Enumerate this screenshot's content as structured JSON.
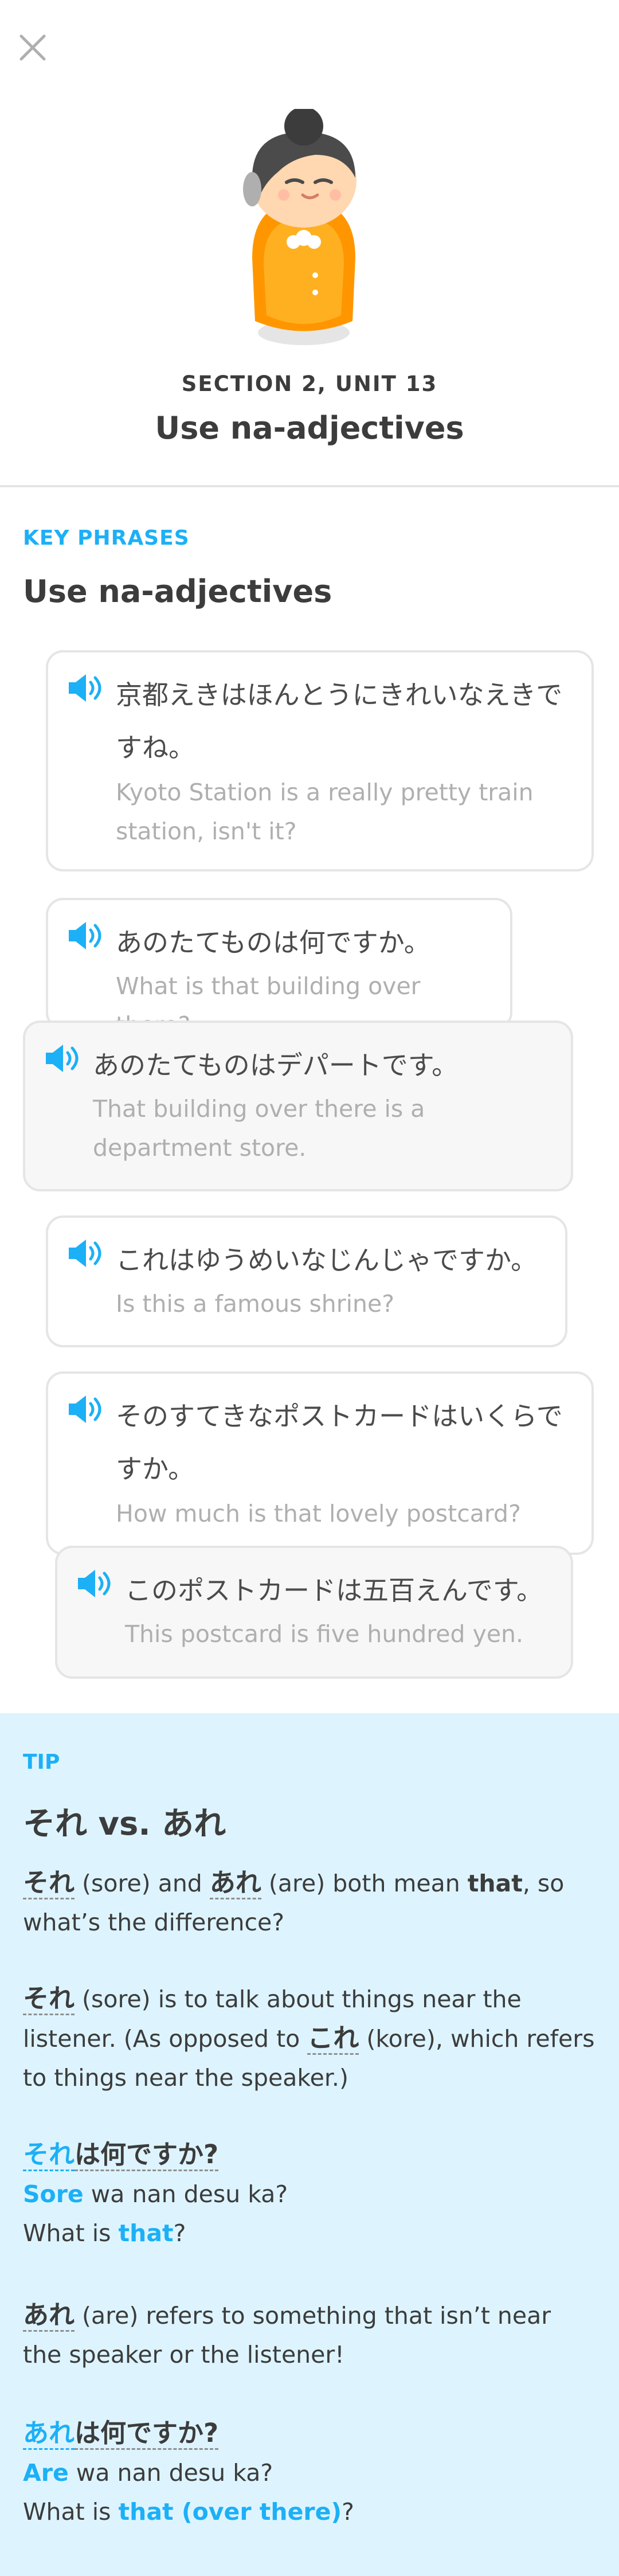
{
  "header": {
    "section_label": "SECTION 2, UNIT 13",
    "unit_title": "Use na-adjectives"
  },
  "key_phrases": {
    "label": "KEY PHRASES",
    "title": "Use na-adjectives",
    "items": [
      {
        "jp": "京都えきはほんとうにきれいなえきですね。",
        "en": "Kyoto Station is a really pretty train station, isn't it?"
      },
      {
        "jp": "あのたてものは何ですか。",
        "en": "What is that building over there?"
      },
      {
        "jp": "あのたてものはデパートです。",
        "en": "That building over there is a department store."
      },
      {
        "jp": "これはゆうめいなじんじゃですか。",
        "en": "Is this a famous shrine?"
      },
      {
        "jp": "そのすてきなポストカードはいくらですか。",
        "en": "How much is that lovely postcard?"
      },
      {
        "jp": "このポストカードは五百えんです。",
        "en": "This postcard is five hundred yen."
      }
    ]
  },
  "tip": {
    "label": "TIP",
    "title_a": "それ",
    "title_vs": " vs. ",
    "title_b": "あれ",
    "p1_a": "それ",
    "p1_b": " (sore) and ",
    "p1_c": "あれ",
    "p1_d": " (are) both mean ",
    "p1_e": "that",
    "p1_f": ", so what’s the difference?",
    "p2_a": "それ",
    "p2_b": " (sore) is to talk about things near the listener. (As opposed to ",
    "p2_c": "これ",
    "p2_d": " (kore), which refers to things near the speaker.)",
    "ex1_jp_a": "それ",
    "ex1_jp_b": "は何ですか?",
    "ex1_rom_a": "Sore",
    "ex1_rom_b": " wa nan desu ka?",
    "ex1_en_a": "What is ",
    "ex1_en_b": "that",
    "ex1_en_c": "?",
    "p3_a": "あれ",
    "p3_b": " (are) refers to something that isn’t near the speaker or the listener!",
    "ex2_jp_a": "あれ",
    "ex2_jp_b": "は何ですか?",
    "ex2_rom_a": "Are",
    "ex2_rom_b": " wa nan desu ka?",
    "ex2_en_a": "What is ",
    "ex2_en_b": "that (over there)",
    "ex2_en_c": "?"
  },
  "colors": {
    "accent": "#1cb0f6",
    "tip_bg": "#ddf4ff",
    "mascot_orange": "#ff9600"
  },
  "icons": [
    "close-icon",
    "speaker-icon",
    "mascot-illustration"
  ]
}
